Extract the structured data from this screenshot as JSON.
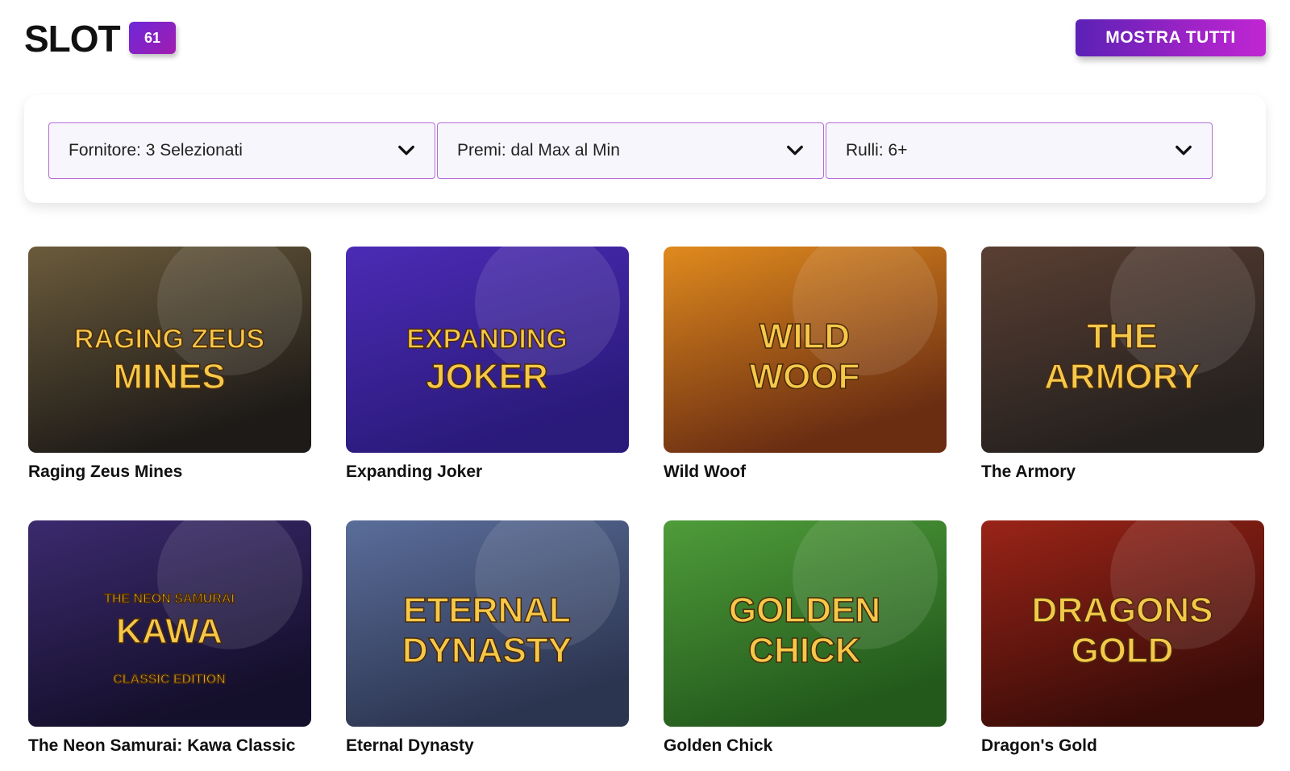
{
  "header": {
    "title": "SLOT",
    "count": "61",
    "show_all_label": "MOSTRA TUTTI"
  },
  "filters": [
    {
      "label": "Fornitore: 3 Selezionati"
    },
    {
      "label": "Premi: dal Max al Min"
    },
    {
      "label": "Rulli: 6+"
    }
  ],
  "games": [
    {
      "name": "Raging Zeus Mines",
      "logo_lines": [
        "RAGING ZEUS",
        "MINES"
      ],
      "colors": [
        "#6b5b3c",
        "#1d1a17"
      ]
    },
    {
      "name": "Expanding Joker",
      "logo_lines": [
        "EXPANDING",
        "JOKER"
      ],
      "colors": [
        "#4b2bb5",
        "#2a1a7a"
      ]
    },
    {
      "name": "Wild Woof",
      "logo_lines": [
        "WILD",
        "WOOF"
      ],
      "colors": [
        "#e08a1e",
        "#6a2d12"
      ]
    },
    {
      "name": "The Armory",
      "logo_lines": [
        "THE",
        "ARMORY"
      ],
      "colors": [
        "#5a3f33",
        "#24201e"
      ]
    },
    {
      "name": "The Neon Samurai: Kawa Classic",
      "logo_lines": [
        "THE NEON SAMURAI",
        "KAWA",
        "CLASSIC EDITION"
      ],
      "colors": [
        "#3b2a6e",
        "#140f2a"
      ]
    },
    {
      "name": "Eternal Dynasty",
      "logo_lines": [
        "ETERNAL",
        "DYNASTY"
      ],
      "colors": [
        "#5a6d9a",
        "#2c3550"
      ]
    },
    {
      "name": "Golden Chick",
      "logo_lines": [
        "GOLDEN",
        "CHICK"
      ],
      "colors": [
        "#4f9c3a",
        "#235a1c"
      ]
    },
    {
      "name": "Dragon's Gold",
      "logo_lines": [
        "DRAGONS",
        "GOLD"
      ],
      "colors": [
        "#9a2418",
        "#3a0c08"
      ]
    }
  ],
  "icons": {
    "chevron": "chevron-down-icon"
  }
}
